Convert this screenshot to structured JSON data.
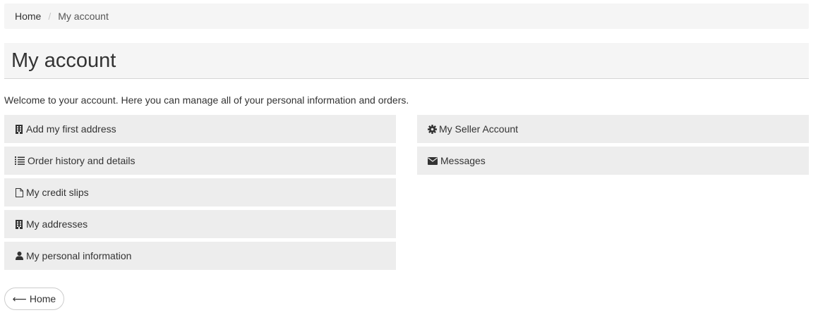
{
  "breadcrumb": {
    "items": [
      {
        "label": "Home"
      },
      {
        "label": "My account"
      }
    ],
    "separator": "/"
  },
  "page_title": "My account",
  "welcome_text": "Welcome to your account. Here you can manage all of your personal information and orders.",
  "left_links": [
    {
      "label": "Add my first address",
      "icon": "building-icon"
    },
    {
      "label": "Order history and details",
      "icon": "list-icon"
    },
    {
      "label": "My credit slips",
      "icon": "file-icon"
    },
    {
      "label": "My addresses",
      "icon": "building-icon"
    },
    {
      "label": "My personal information",
      "icon": "user-icon"
    }
  ],
  "right_links": [
    {
      "label": "My Seller Account",
      "icon": "gear-icon"
    },
    {
      "label": "Messages",
      "icon": "envelope-icon"
    }
  ],
  "home_button": {
    "arrow": "⟵",
    "label": "Home"
  },
  "colors": {
    "link_box_bg": "#ededed",
    "header_bg": "#f5f5f5",
    "text": "#333333"
  }
}
